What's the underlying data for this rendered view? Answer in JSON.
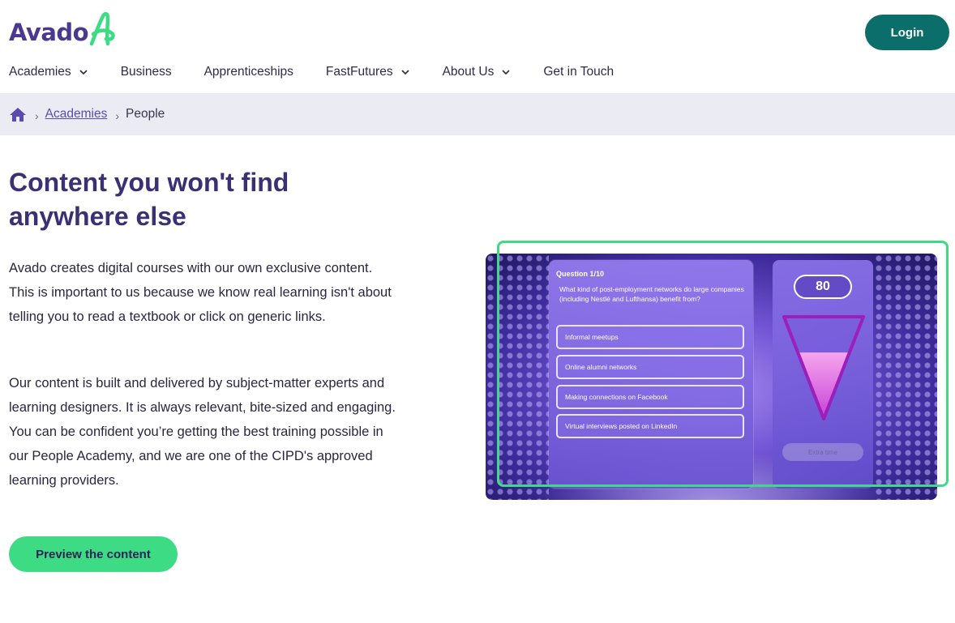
{
  "header": {
    "logo_text": "Avado",
    "login_label": "Login"
  },
  "nav": {
    "items": [
      {
        "label": "Academies",
        "has_dropdown": true
      },
      {
        "label": "Business",
        "has_dropdown": false
      },
      {
        "label": "Apprenticeships",
        "has_dropdown": false
      },
      {
        "label": "FastFutures",
        "has_dropdown": true
      },
      {
        "label": "About Us",
        "has_dropdown": true
      },
      {
        "label": "Get in Touch",
        "has_dropdown": false
      }
    ]
  },
  "breadcrumb": {
    "home_icon": "home-icon",
    "link_label": "Academies",
    "current_label": "People"
  },
  "main": {
    "heading": "Content you won't find anywhere else",
    "paragraph1": "Avado creates digital courses with our own exclusive content. This is important to us because we know real learning isn't about telling you to read a textbook or click on generic links.",
    "paragraph2": "Our content is built and delivered by subject-matter experts and learning designers. It is always relevant, bite-sized and engaging. You can be confident you’re getting the best training possible in our People Academy, and we are one of the CIPD's approved learning providers.",
    "preview_label": "Preview the content"
  },
  "game": {
    "question_number": "Question 1/10",
    "question_text": "What kind of post-employment networks do large companies (including Nestlé and Lufthansa) benefit from?",
    "answers": [
      "Informal meetups",
      "Online alumni networks",
      "Making connections on Facebook",
      "Virtual interviews posted on LinkedIn"
    ],
    "score": "80",
    "extra_time_label": "Extra time",
    "timer_fill_fraction": 0.65
  },
  "colors": {
    "brand_purple": "#4a3a8f",
    "heading_purple": "#3b3074",
    "login_teal": "#0c6e6a",
    "accent_green": "#3ddc84",
    "breadcrumb_bg": "#ebebf3"
  }
}
